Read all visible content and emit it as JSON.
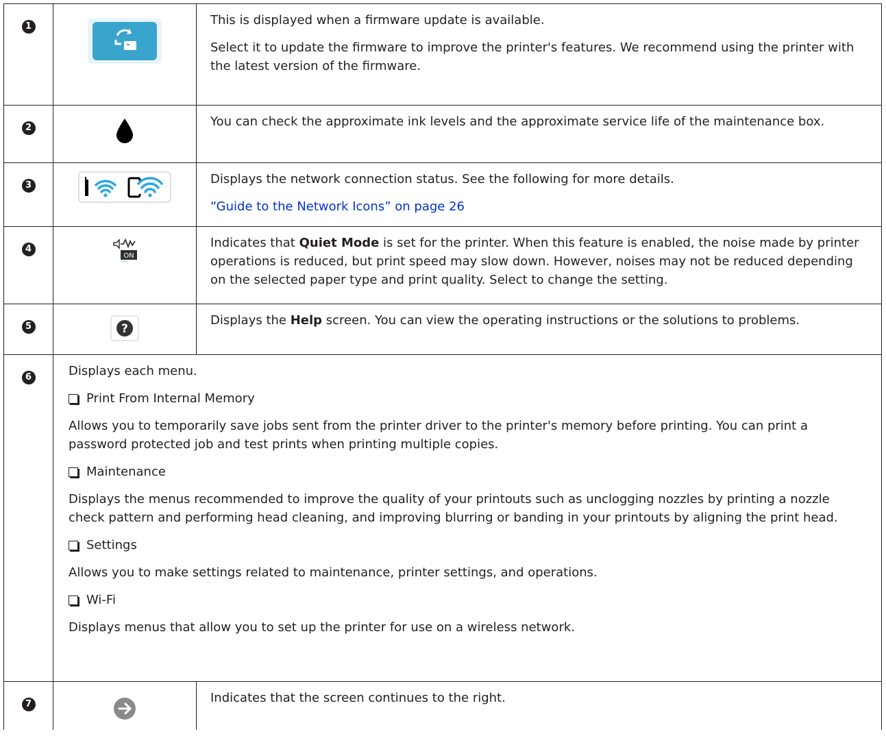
{
  "rows": [
    {
      "badge": "1",
      "icon": "firmware-update-icon",
      "lines": [
        "This is displayed when a firmware update is available.",
        "Select it to update the firmware to improve the printer's features. We recommend using the printer with the latest version of the firmware."
      ]
    },
    {
      "badge": "2",
      "icon": "ink-drop-icon",
      "lines": [
        "You can check the approximate ink levels and the approximate service life of the maintenance box."
      ]
    },
    {
      "badge": "3",
      "icon": "wifi-status-icon",
      "lines": [
        "Displays the network connection status. See the following for more details."
      ],
      "link": "“Guide to the Network Icons” on page 26"
    },
    {
      "badge": "4",
      "icon": "quiet-mode-on-icon",
      "pre": "Indicates that ",
      "bold": "Quiet Mode",
      "post": " is set for the printer. When this feature is enabled, the noise made by printer operations is reduced, but print speed may slow down. However, noises may not be reduced depending on the selected paper type and print quality. Select to change the setting."
    },
    {
      "badge": "5",
      "icon": "help-icon",
      "pre": "Displays the ",
      "bold": "Help",
      "post": " screen. You can view the operating instructions or the solutions to problems."
    },
    {
      "badge": "6",
      "intro": "Displays each menu.",
      "items": [
        {
          "title": "Print From Internal Memory",
          "desc": "Allows you to temporarily save jobs sent from the printer driver to the printer's memory before printing. You can print a password protected job and test prints when printing multiple copies."
        },
        {
          "title": "Maintenance",
          "desc": "Displays the menus recommended to improve the quality of your printouts such as unclogging nozzles by printing a nozzle check pattern and performing head cleaning, and improving blurring or banding in your printouts by aligning the print head."
        },
        {
          "title": "Settings",
          "desc": "Allows you to make settings related to maintenance, printer settings, and operations."
        },
        {
          "title": "Wi-Fi",
          "desc": "Displays menus that allow you to set up the printer for use on a wireless network."
        }
      ]
    },
    {
      "badge": "7",
      "icon": "arrow-right-icon",
      "lines": [
        "Indicates that the screen continues to the right."
      ]
    }
  ]
}
